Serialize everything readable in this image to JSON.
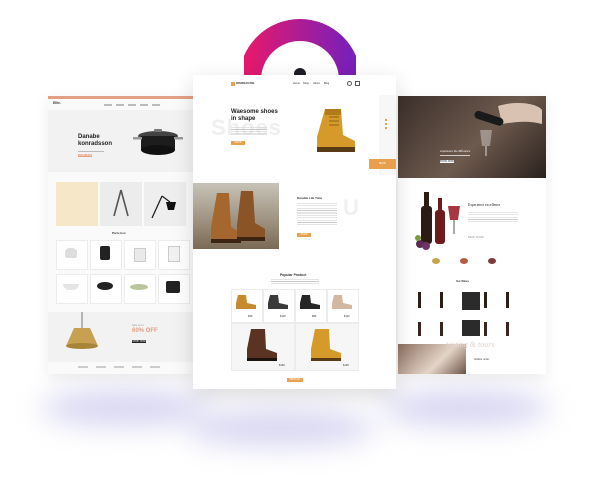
{
  "accent": {
    "pink": "#d6207b",
    "purple": "#7a1fb8",
    "orange": "#e8a04c",
    "rose": "#e3a082",
    "dark": "#1e1e1e"
  },
  "left_page": {
    "logo": "Ellie.",
    "hero_title_line1": "Danabe",
    "hero_title_line2": "konradsson",
    "hero_button": "SHOP NOW",
    "section_title": "Parts box",
    "sale_text": "60% OFF",
    "sale_pretext": "Sale up to",
    "sale_button": "SHOP NOW"
  },
  "center_page": {
    "logo": "WAREHOUSE",
    "nav": [
      "Home",
      "Shop",
      "About",
      "Blog"
    ],
    "hero_line1": "Waesome shoes",
    "hero_line2": "in shape",
    "hero_button": "SHOP NOW",
    "bg_word": "Shoes",
    "feature_title": "Durable Life Time",
    "feature_button": "SHOP NOW",
    "side_button": "SHOP",
    "popular_title": "Popular Product",
    "load_button": "VIEW ALL",
    "prod_labels": [
      "$99",
      "$120",
      "$89",
      "$110",
      "$150",
      "$135"
    ]
  },
  "right_page": {
    "hero_caption": "experience the difference",
    "hero_button": "BOOK NOW",
    "story_title": "Experience excellence",
    "story_button": "READ MORE",
    "script_text": "tasting & tours",
    "script_sub": "Online order",
    "shop_title": "Our Wines"
  }
}
